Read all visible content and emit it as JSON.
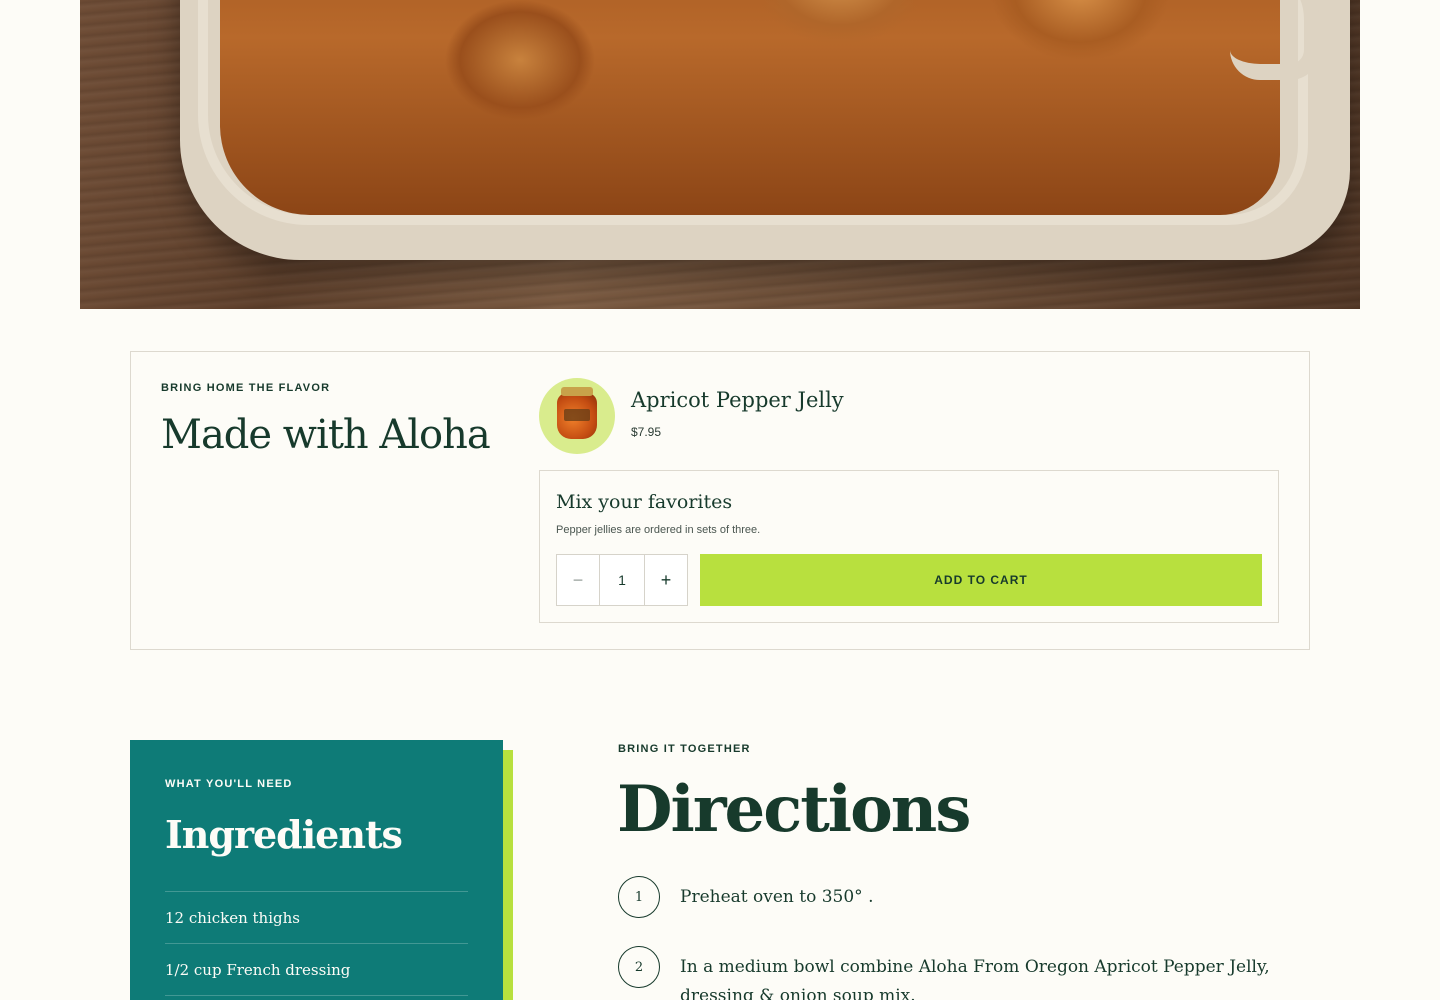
{
  "hero": {
    "image_alt": "baked-chicken-dish-photo"
  },
  "product_section": {
    "eyebrow": "BRING HOME THE FLAVOR",
    "headline": "Made with Aloha",
    "product": {
      "name": "Apricot Pepper Jelly",
      "price": "$7.95",
      "thumb_icon": "jar-icon"
    },
    "mix": {
      "title": "Mix your favorites",
      "note": "Pepper jellies are ordered in sets of three.",
      "quantity": "1",
      "minus_label": "−",
      "plus_label": "+",
      "add_to_cart_label": "ADD TO CART"
    }
  },
  "ingredients": {
    "eyebrow": "WHAT YOU'LL NEED",
    "title": "Ingredients",
    "items": [
      "12 chicken thighs",
      "1/2 cup French dressing",
      ""
    ]
  },
  "directions": {
    "eyebrow": "BRING IT TOGETHER",
    "title": "Directions",
    "steps": [
      {
        "num": "1",
        "text": "Preheat oven to 350° ."
      },
      {
        "num": "2",
        "text": "In a medium bowl combine Aloha From Oregon Apricot Pepper Jelly, dressing & onion soup mix."
      }
    ]
  },
  "colors": {
    "background": "#fdfcf7",
    "brand_green": "#173a2c",
    "accent_lime": "#b8e03e",
    "teal": "#0e7b77"
  }
}
